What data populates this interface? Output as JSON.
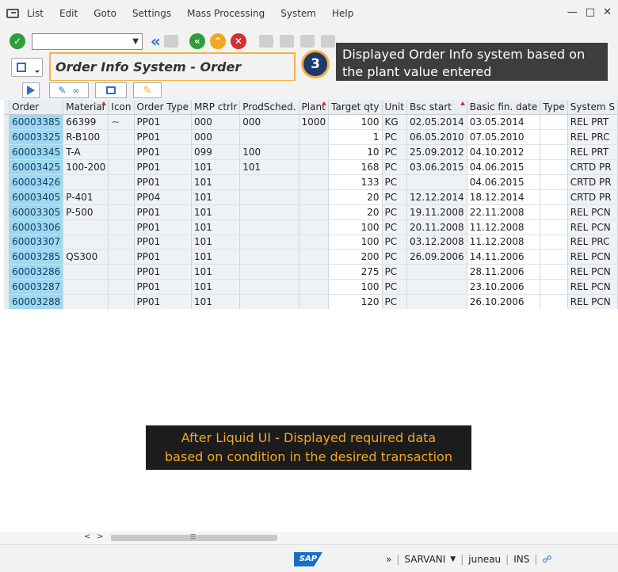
{
  "menu": {
    "items": [
      {
        "label": "List"
      },
      {
        "label": "Edit"
      },
      {
        "label": "Goto"
      },
      {
        "label": "Settings"
      },
      {
        "label": "Mass Processing"
      },
      {
        "label": "System"
      },
      {
        "label": "Help"
      }
    ]
  },
  "title": "Order Info System - Order Headers",
  "step_number": "3",
  "callout_text": "Displayed Order Info system based on the plant value entered",
  "caption_line1": "After Liquid UI - Displayed required data",
  "caption_line2": "based on condition in the desired transaction",
  "table": {
    "headers": [
      "Order",
      "Material",
      "Icon",
      "Order Type",
      "MRP ctrlr",
      "ProdSched.",
      "Plant",
      "Target qty",
      "Unit",
      "Bsc start",
      "Basic fin. date",
      "Type",
      "System S"
    ],
    "rows": [
      [
        "60003385",
        "66399",
        "~",
        "PP01",
        "000",
        "000",
        "1000",
        "100",
        "KG",
        "02.05.2014",
        "03.05.2014",
        "",
        "REL  PRT"
      ],
      [
        "60003325",
        "R-B100",
        "",
        "PP01",
        "000",
        "",
        "",
        "1",
        "PC",
        "06.05.2010",
        "07.05.2010",
        "",
        "REL  PRC"
      ],
      [
        "60003345",
        "T-A",
        "",
        "PP01",
        "099",
        "100",
        "",
        "10",
        "PC",
        "25.09.2012",
        "04.10.2012",
        "",
        "REL  PRT"
      ],
      [
        "60003425",
        "100-200",
        "",
        "PP01",
        "101",
        "101",
        "",
        "168",
        "PC",
        "03.06.2015",
        "04.06.2015",
        "",
        "CRTD PR"
      ],
      [
        "60003426",
        "",
        "",
        "PP01",
        "101",
        "",
        "",
        "133",
        "PC",
        "",
        "04.06.2015",
        "",
        "CRTD PR"
      ],
      [
        "60003405",
        "P-401",
        "",
        "PP04",
        "101",
        "",
        "",
        "20",
        "PC",
        "12.12.2014",
        "18.12.2014",
        "",
        "CRTD PR"
      ],
      [
        "60003305",
        "P-500",
        "",
        "PP01",
        "101",
        "",
        "",
        "20",
        "PC",
        "19.11.2008",
        "22.11.2008",
        "",
        "REL  PCN"
      ],
      [
        "60003306",
        "",
        "",
        "PP01",
        "101",
        "",
        "",
        "100",
        "PC",
        "20.11.2008",
        "11.12.2008",
        "",
        "REL  PCN"
      ],
      [
        "60003307",
        "",
        "",
        "PP01",
        "101",
        "",
        "",
        "100",
        "PC",
        "03.12.2008",
        "11.12.2008",
        "",
        "REL  PRC"
      ],
      [
        "60003285",
        "QS300",
        "",
        "PP01",
        "101",
        "",
        "",
        "200",
        "PC",
        "26.09.2006",
        "14.11.2006",
        "",
        "REL  PCN"
      ],
      [
        "60003286",
        "",
        "",
        "PP01",
        "101",
        "",
        "",
        "275",
        "PC",
        "",
        "28.11.2006",
        "",
        "REL  PCN"
      ],
      [
        "60003287",
        "",
        "",
        "PP01",
        "101",
        "",
        "",
        "100",
        "PC",
        "",
        "23.10.2006",
        "",
        "REL  PCN"
      ],
      [
        "60003288",
        "",
        "",
        "PP01",
        "101",
        "",
        "",
        "120",
        "PC",
        "",
        "26.10.2006",
        "",
        "REL  PCN"
      ]
    ]
  },
  "status": {
    "user": "SARVANI",
    "server": "juneau",
    "mode": "INS"
  },
  "colors": {
    "accent": "#f3b23b",
    "badge": "#1e3a6d",
    "order_cell": "#9ed9ef",
    "caption_text": "#f5a623"
  }
}
